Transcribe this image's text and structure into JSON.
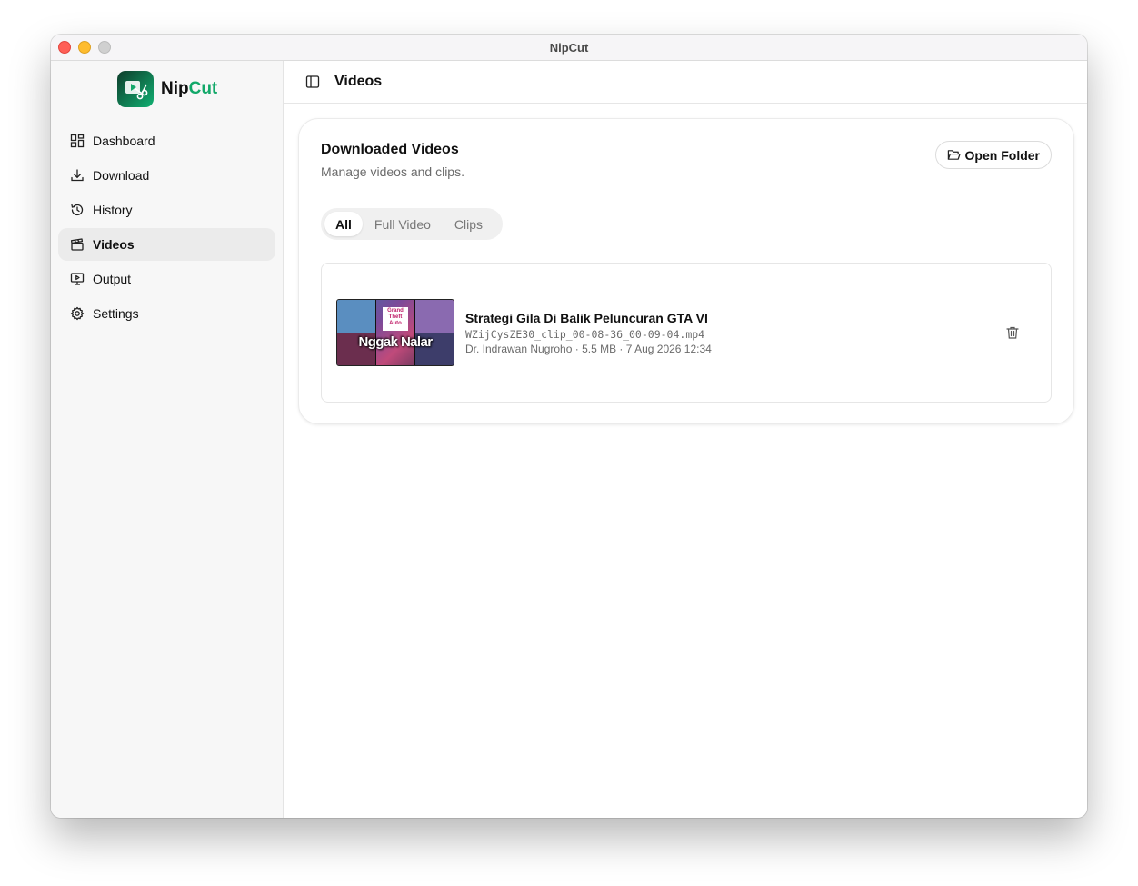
{
  "window": {
    "title": "NipCut"
  },
  "brand": {
    "name_part1": "Nip",
    "name_part2": "Cut",
    "logo_icon": "video-scissors-logo",
    "accent_color": "#12a869"
  },
  "sidebar": {
    "items": [
      {
        "label": "Dashboard",
        "icon": "dashboard-icon",
        "active": false
      },
      {
        "label": "Download",
        "icon": "download-icon",
        "active": false
      },
      {
        "label": "History",
        "icon": "history-icon",
        "active": false
      },
      {
        "label": "Videos",
        "icon": "clapperboard-icon",
        "active": true
      },
      {
        "label": "Output",
        "icon": "monitor-icon",
        "active": false
      },
      {
        "label": "Settings",
        "icon": "gear-icon",
        "active": false
      }
    ]
  },
  "header": {
    "title": "Videos",
    "toggle_icon": "sidebar-toggle-icon"
  },
  "card": {
    "title": "Downloaded Videos",
    "subtitle": "Manage videos and clips.",
    "open_folder_label": "Open Folder"
  },
  "tabs": [
    {
      "label": "All",
      "active": true
    },
    {
      "label": "Full Video",
      "active": false
    },
    {
      "label": "Clips",
      "active": false
    }
  ],
  "videos": [
    {
      "title": "Strategi Gila Di Balik Peluncuran GTA VI",
      "filename": "WZijCysZE30_clip_00-08-36_00-09-04.mp4",
      "info": "Dr. Indrawan Nugroho · 5.5 MB · 7 Aug 2026 12:34",
      "thumbnail_caption": "Nggak Nalar",
      "thumbnail_logo_text": "Grand Theft Auto"
    }
  ]
}
